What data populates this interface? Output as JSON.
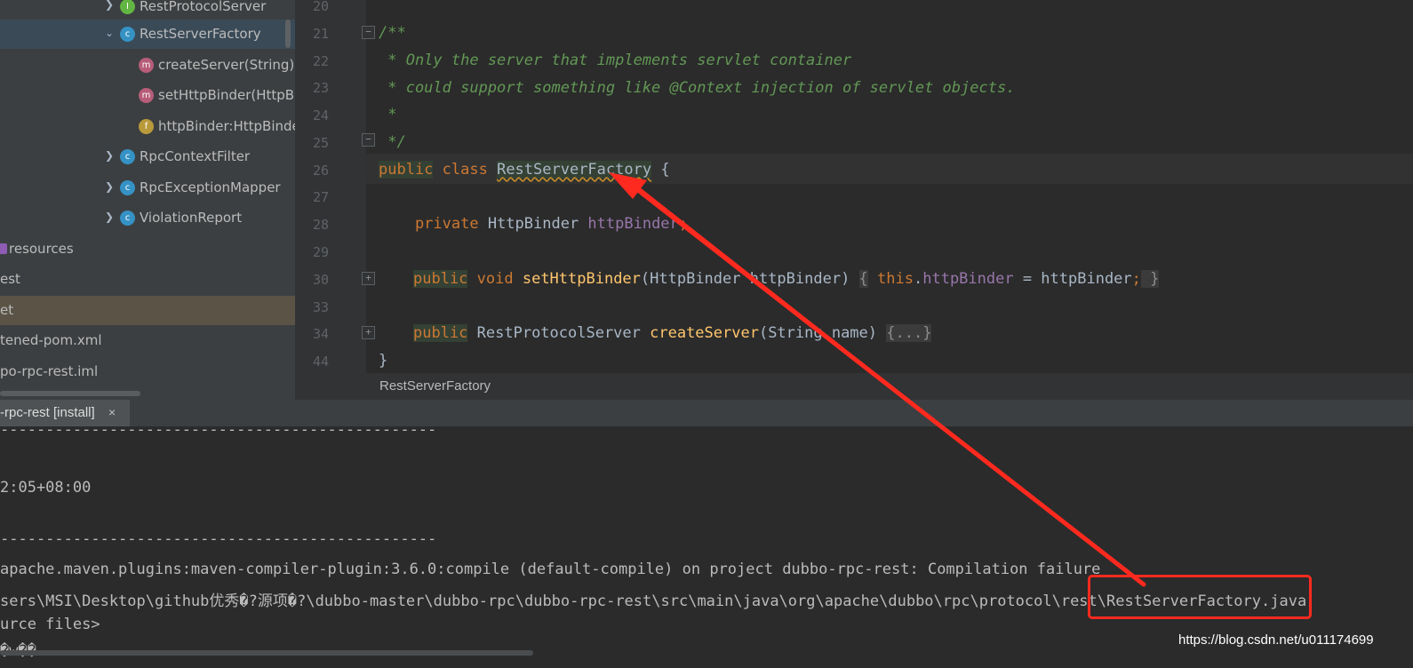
{
  "tree": {
    "items": [
      {
        "label": "RestProtocolServer",
        "badge": "I"
      },
      {
        "label": "RestServerFactory",
        "badge": "c"
      },
      {
        "label": "createServer(String):F",
        "badge": "m"
      },
      {
        "label": "setHttpBinder(HttpBi",
        "badge": "m"
      },
      {
        "label": "httpBinder:HttpBinde",
        "badge": "f"
      },
      {
        "label": "RpcContextFilter",
        "badge": "c"
      },
      {
        "label": "RpcExceptionMapper",
        "badge": "c"
      },
      {
        "label": "ViolationReport",
        "badge": "c"
      },
      {
        "label": "resources"
      },
      {
        "label": "est"
      },
      {
        "label": "et"
      },
      {
        "label": "tened-pom.xml"
      },
      {
        "label": "po-rpc-rest.iml"
      }
    ]
  },
  "editor": {
    "line_numbers": [
      "20",
      "21",
      "22",
      "23",
      "24",
      "25",
      "26",
      "27",
      "28",
      "29",
      "30",
      "33",
      "34",
      "44"
    ],
    "fold_plus": "+",
    "fold_minus": "−",
    "code": {
      "l21": "/**",
      "l22": " * Only the server that implements servlet container",
      "l23": " * could support something like @Context injection of servlet objects.",
      "l24": " *",
      "l25": " */",
      "l26_public": "public",
      "l26_class": " class ",
      "l26_name": "RestServerFactory",
      "l26_brace": " {",
      "l28_private": "    private",
      "l28_type": " HttpBinder ",
      "l28_field": "httpBinder",
      "l28_semi": ";",
      "l30_public": "public",
      "l30_void": " void ",
      "l30_fn": "setHttpBinder",
      "l30_params": "(HttpBinder httpBinder) ",
      "l30_ob": "{",
      "l30_this": " this",
      "l30_dot": ".",
      "l30_field": "httpBinder",
      "l30_assign": " = httpBinder",
      "l30_semi": ";",
      "l30_cb": " }",
      "l34_public": "public",
      "l34_type": " RestProtocolServer ",
      "l34_fn": "createServer",
      "l34_params": "(String name) ",
      "l34_folded": "{...}",
      "l44": "}"
    },
    "breadcrumb": "RestServerFactory"
  },
  "run": {
    "tab_label": "-rpc-rest [install]",
    "close": "×",
    "lines": [
      "------------------------------------------------",
      "",
      "2:05+08:00",
      "",
      "------------------------------------------------",
      "apache.maven.plugins:maven-compiler-plugin:3.6.0:compile (default-compile) on project dubbo-rpc-rest: Compilation failure",
      "sers\\MSI\\Desktop\\github优秀�?源项�?\\dubbo-master\\dubbo-rpc\\dubbo-rpc-rest\\src\\main\\java\\org\\apache\\dubbo\\rpc\\protocol\\rest\\RestServerFactory.java",
      "urce files>",
      "�w��"
    ]
  },
  "watermark": "https://blog.csdn.net/u011174699",
  "colors": {
    "annotation": "#ff2a1f",
    "comment": "#629755",
    "keyword": "#cc7832",
    "method": "#ffc66d",
    "field": "#9876aa"
  }
}
